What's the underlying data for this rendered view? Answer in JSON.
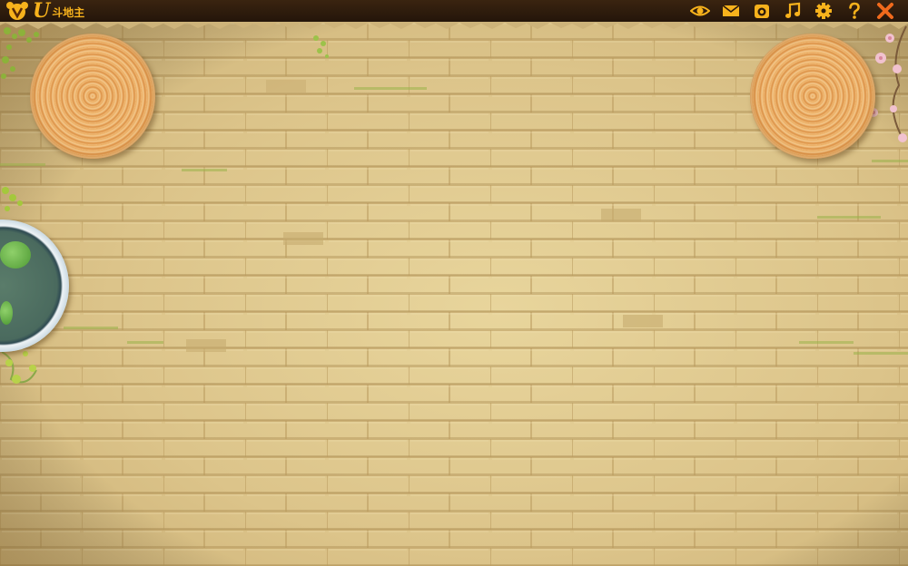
{
  "app": {
    "title": "斗地主",
    "logo_letter": "U",
    "accent_color": "#f7b21c",
    "titlebar_color": "#2b1a0c"
  },
  "toolbar": {
    "buttons": [
      {
        "name": "eye-icon"
      },
      {
        "name": "mail-icon"
      },
      {
        "name": "camera-icon"
      },
      {
        "name": "music-note-icon"
      },
      {
        "name": "gear-icon"
      },
      {
        "name": "help-icon"
      },
      {
        "name": "close-icon"
      }
    ]
  },
  "scene": {
    "background": "brick-wall",
    "decorations": [
      "straw-mat-left",
      "straw-mat-right",
      "pond-bowl",
      "vines",
      "blossoms"
    ]
  }
}
